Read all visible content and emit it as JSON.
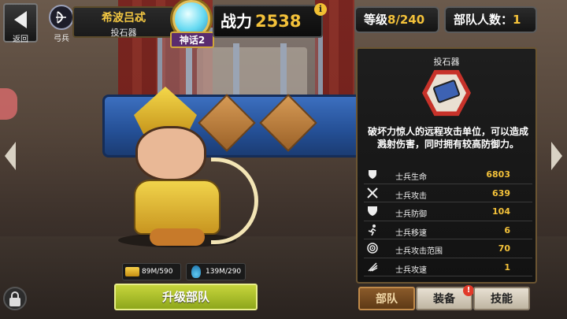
{
  "header": {
    "back_label": "返回",
    "class_label": "弓兵",
    "hero_name": "希波吕忒",
    "unit_type": "投石器",
    "rank_label": "神话2",
    "power_label": "战力",
    "power_value": "2538",
    "info_glyph": "i",
    "level_label": "等级",
    "level_value": "8/240",
    "troops_label": "部队人数：",
    "troops_value": "1"
  },
  "panel": {
    "title": "投石器",
    "description": "破坏力惊人的远程攻击单位，可以造成溅射伤害，同时拥有较高防御力。",
    "stats": [
      {
        "icon": "heart-shield-icon",
        "label": "士兵生命",
        "value": "6803"
      },
      {
        "icon": "crossed-swords-icon",
        "label": "士兵攻击",
        "value": "639"
      },
      {
        "icon": "shield-icon",
        "label": "士兵防御",
        "value": "104"
      },
      {
        "icon": "running-icon",
        "label": "士兵移速",
        "value": "6"
      },
      {
        "icon": "target-icon",
        "label": "士兵攻击范围",
        "value": "70"
      },
      {
        "icon": "wing-speed-icon",
        "label": "士兵攻速",
        "value": "1"
      }
    ]
  },
  "resources": {
    "gold": "89M/590",
    "potion": "139M/290"
  },
  "actions": {
    "upgrade_label": "升级部队"
  },
  "tabs": [
    {
      "label": "部队",
      "active": true
    },
    {
      "label": "装备",
      "active": false,
      "alert": "!"
    },
    {
      "label": "技能",
      "active": false
    }
  ],
  "colors": {
    "accent_gold": "#f4c23a",
    "upgrade_green": "#a9bd2a",
    "emblem_red": "#c7322a"
  }
}
